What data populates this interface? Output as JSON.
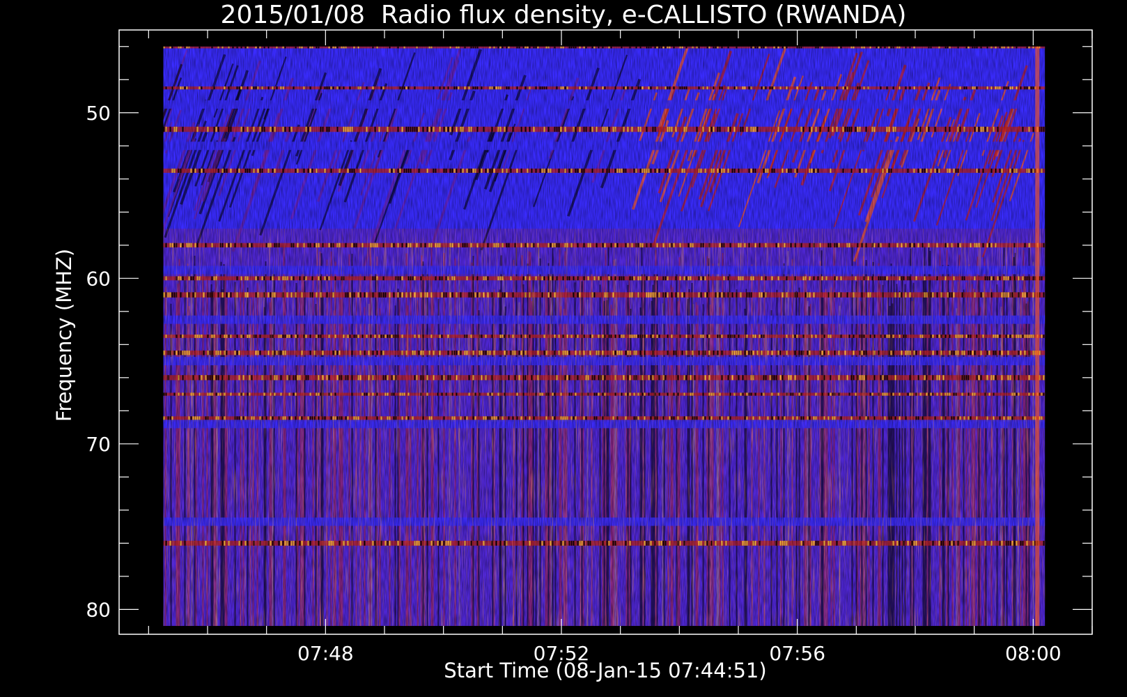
{
  "chart_data": {
    "type": "heatmap",
    "title": "2015/01/08  Radio flux density, e-CALLISTO (RWANDA)",
    "xlabel": "Start Time (08-Jan-15 07:44:51)",
    "ylabel": "Frequency (MHZ)",
    "x_ticks": [
      "07:48",
      "07:52",
      "07:56",
      "08:00"
    ],
    "x_tick_minutes": [
      48,
      52,
      56,
      60
    ],
    "y_ticks": [
      50,
      60,
      70,
      80
    ],
    "ylim": [
      45,
      81.5
    ],
    "xlim_minutes": [
      44.5,
      61
    ],
    "data_x_range_minutes": [
      45.25,
      60.2
    ],
    "data_y_range_mhz": [
      46,
      81
    ],
    "y_axis_inverted": true,
    "colormap": [
      "#000000",
      "#2a1acd",
      "#3a2cff",
      "#7a1f8f",
      "#c3221e",
      "#ff5a1a",
      "#ffd23a"
    ],
    "rfi_bands_mhz": [
      46,
      48.5,
      51,
      53.5,
      58,
      60,
      61,
      63.5,
      64.5,
      66,
      67,
      68.5,
      76
    ],
    "quiet_bands_mhz": [
      49.5,
      52,
      59.5,
      62.5,
      65,
      68.8,
      74.7
    ],
    "colors": {
      "background": "#000000",
      "axis": "#ffffff",
      "text": "#ffffff"
    }
  }
}
